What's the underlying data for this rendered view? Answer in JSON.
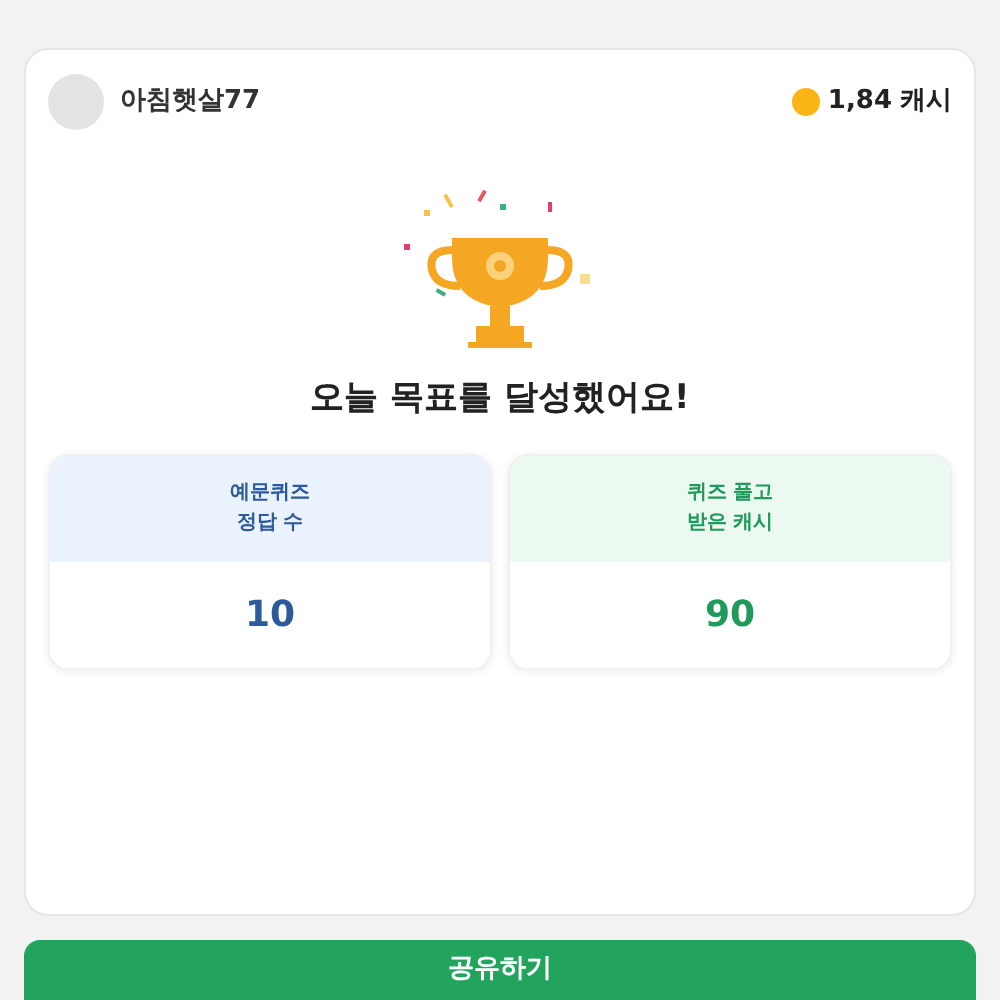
{
  "user": {
    "name": "아침햇살77"
  },
  "cash": {
    "amount": "1,84",
    "unit": "캐시"
  },
  "title": "오늘 목표를 달성했어요!",
  "stats": [
    {
      "kind": "blue",
      "label": [
        "예문퀴즈",
        "정답 수"
      ],
      "value": "10"
    },
    {
      "kind": "green",
      "label": [
        "퀴즈 풀고",
        "받은 캐시"
      ],
      "value": "90"
    }
  ],
  "share_button": "공유하기"
}
